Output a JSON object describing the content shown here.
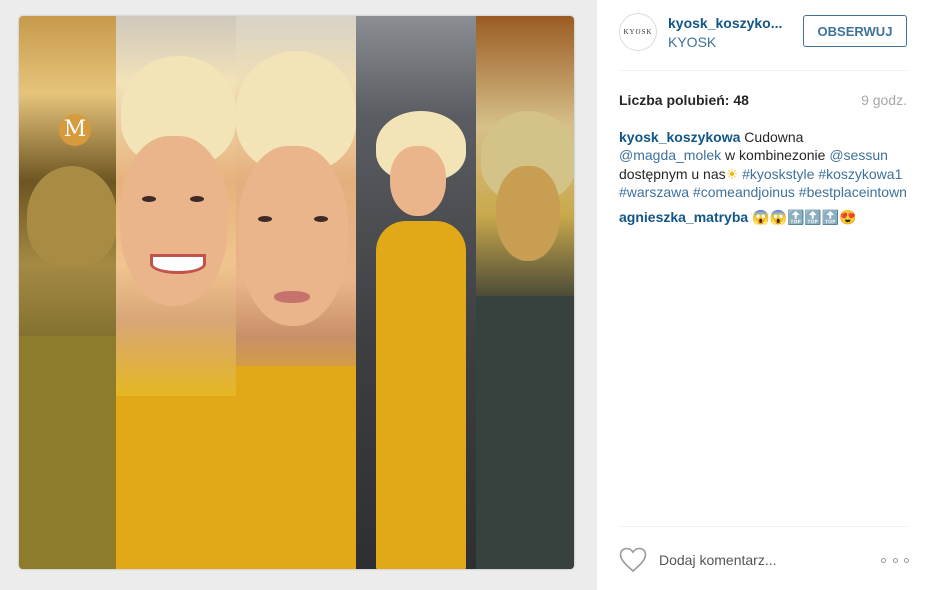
{
  "post": {
    "image_alt": "",
    "username": "kyosk_koszykowa",
    "username_display": "kyosk_koszyko...",
    "location": "KYOSK",
    "avatar_text": "KYOSK",
    "follow_label": "OBSERWUJ",
    "likes_label": "Liczba polubień: 48",
    "time_ago": "9 godz."
  },
  "caption": {
    "author": "kyosk_koszykowa",
    "text_1": "Cudowna",
    "mention_1": "@magda_molek",
    "text_2": "w kombinezonie",
    "mention_2": "@sessun",
    "text_3": "dostępnym u nas",
    "emoji_sun": "☀",
    "hashtags_1": [
      "#kyoskstyle"
    ],
    "hashtags_2": [
      "#koszykowa1",
      "#warszawa",
      "#comeandjoinus"
    ],
    "hashtags_3": [
      "#bestplaceintown"
    ]
  },
  "comment": {
    "author": "agnieszka_matryba",
    "text": "😱😱🔝🔝🔝😍"
  },
  "footer": {
    "comment_placeholder": "Dodaj komentarz...",
    "like_icon": "heart-icon",
    "more_icon": "more-options-icon"
  },
  "colors": {
    "link": "#3f729b",
    "username": "#125688",
    "muted": "#a5a7aa"
  }
}
